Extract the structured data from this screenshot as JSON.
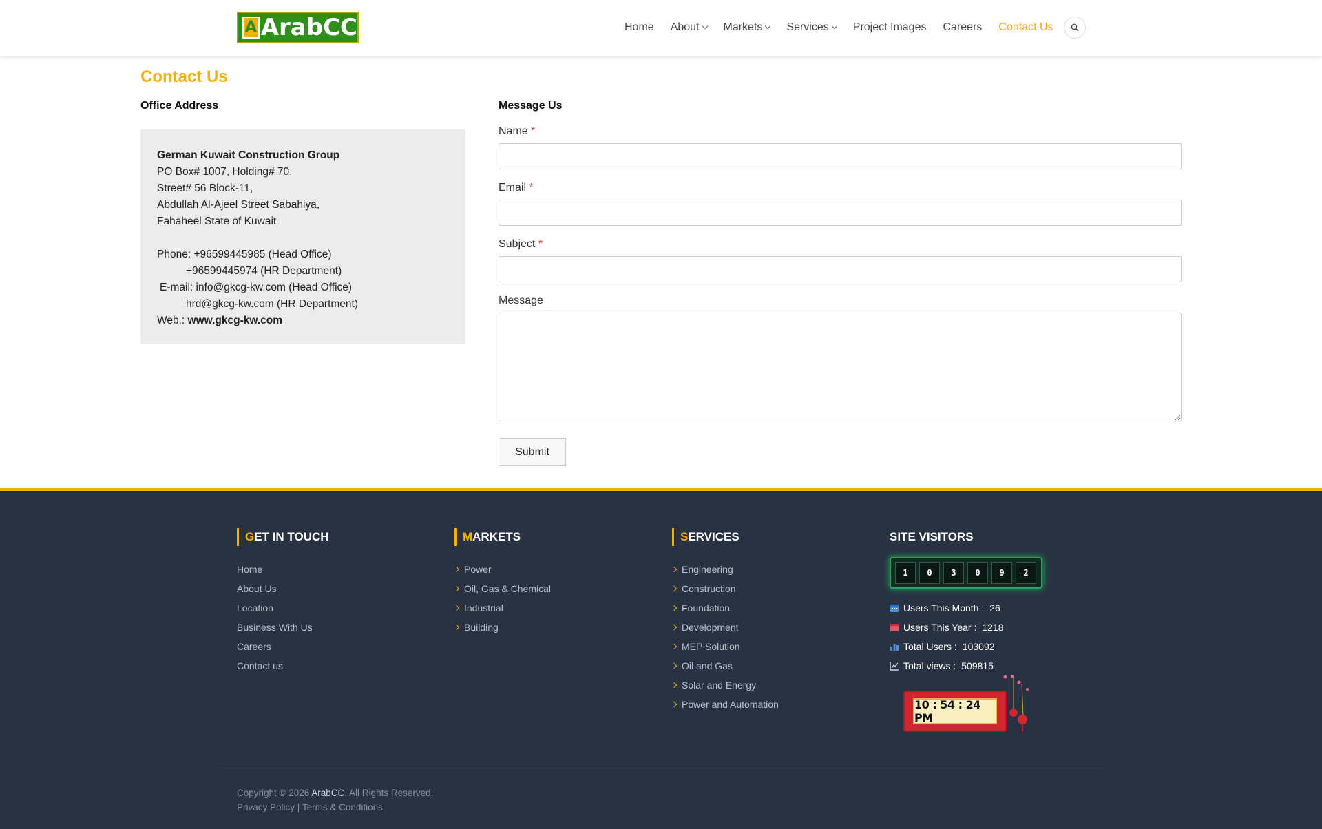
{
  "logo": {
    "mark_letter": "A",
    "text": "ArabCC"
  },
  "nav": {
    "items": [
      {
        "label": "Home",
        "dropdown": false,
        "active": false
      },
      {
        "label": "About",
        "dropdown": true,
        "active": false
      },
      {
        "label": "Markets",
        "dropdown": true,
        "active": false
      },
      {
        "label": "Services",
        "dropdown": true,
        "active": false
      },
      {
        "label": "Project Images",
        "dropdown": false,
        "active": false
      },
      {
        "label": "Careers",
        "dropdown": false,
        "active": false
      },
      {
        "label": "Contact Us",
        "dropdown": false,
        "active": true
      }
    ],
    "search_icon": "search-icon"
  },
  "page": {
    "title": "Contact Us"
  },
  "office": {
    "heading": "Office Address",
    "company": "German Kuwait Construction Group",
    "address_lines": [
      "PO Box# 1007, Holding# 70,",
      "Street# 56 Block-11,",
      "Abdullah Al-Ajeel Street Sabahiya,",
      "Fahaheel State of Kuwait"
    ],
    "phone_label": "Phone:",
    "phone_1": "+96599445985 (Head Office)",
    "phone_2": "+96599445974 (HR Department)",
    "email_label": "E-mail:",
    "email_1": "info@gkcg-kw.com (Head Office)",
    "email_2": "hrd@gkcg-kw.com (HR Department)",
    "web_label": "Web.:",
    "web": "www.gkcg-kw.com"
  },
  "form": {
    "heading": "Message Us",
    "name_label": "Name",
    "email_label": "Email",
    "subject_label": "Subject",
    "message_label": "Message",
    "required_mark": "*",
    "name_value": "",
    "email_value": "",
    "subject_value": "",
    "message_value": "",
    "submit_label": "Submit"
  },
  "footer": {
    "accent_color": "#f0b20a",
    "bg_color": "#283242",
    "get_in_touch": {
      "first": "G",
      "rest": "ET IN TOUCH",
      "links": [
        "Home",
        "About Us",
        "Location",
        "Business With Us",
        "Careers",
        "Contact us"
      ]
    },
    "markets": {
      "first": "M",
      "rest": "ARKETS",
      "links": [
        "Power",
        "Oil, Gas & Chemical",
        "Industrial",
        "Building"
      ]
    },
    "services": {
      "first": "S",
      "rest": "ERVICES",
      "links": [
        "Engineering",
        "Construction",
        "Foundation",
        "Development",
        "MEP Solution",
        "Oil and Gas",
        "Solar and Energy",
        "Power and Automation"
      ]
    },
    "visitors": {
      "title": "SITE VISITORS",
      "digits": [
        "1",
        "0",
        "3",
        "0",
        "9",
        "2"
      ],
      "users_month_label": "Users This Month :",
      "users_month": "26",
      "users_year_label": "Users This Year :",
      "users_year": "1218",
      "total_users_label": "Total Users :",
      "total_users": "103092",
      "total_views_label": "Total views :",
      "total_views": "509815",
      "clock": "10 : 54 : 24 PM"
    },
    "copyright_prefix": "Copyright © 2026",
    "copyright_brand": "ArabCC",
    "copyright_suffix": ". All Rights Reserved.",
    "privacy": "Privacy Policy",
    "separator": "|",
    "terms": "Terms & Conditions"
  }
}
